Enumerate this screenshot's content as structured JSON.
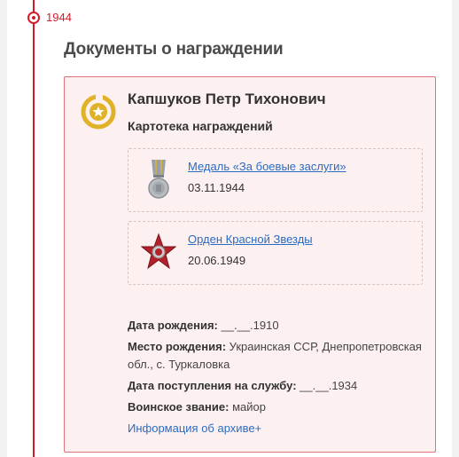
{
  "timeline": {
    "year": "1944"
  },
  "section": {
    "title": "Документы о награждении"
  },
  "card": {
    "person_name": "Капшуков Петр Тихонович",
    "subtitle": "Картотека награждений",
    "awards": [
      {
        "name": "Медаль «За боевые заслуги»",
        "date": "03.11.1944",
        "icon": "medal-icon"
      },
      {
        "name": "Орден Красной Звезды",
        "date": "20.06.1949",
        "icon": "red-star-order-icon"
      }
    ],
    "info": {
      "birth_date_label": "Дата рождения:",
      "birth_date_value": "__.__.1910",
      "birth_place_label": "Место рождения:",
      "birth_place_value": "Украинская ССР, Днепропетровская обл., с. Туркаловка",
      "service_start_label": "Дата поступления на службу:",
      "service_start_value": "__.__.1934",
      "rank_label": "Воинское звание:",
      "rank_value": "майор",
      "archive_link": "Информация об архиве+"
    }
  },
  "colors": {
    "accent_red": "#d21c2a",
    "card_bg": "#fdf0f0",
    "card_border": "#e0737b",
    "link_blue": "#2a6cc2",
    "emblem_gold": "#e0b227"
  }
}
